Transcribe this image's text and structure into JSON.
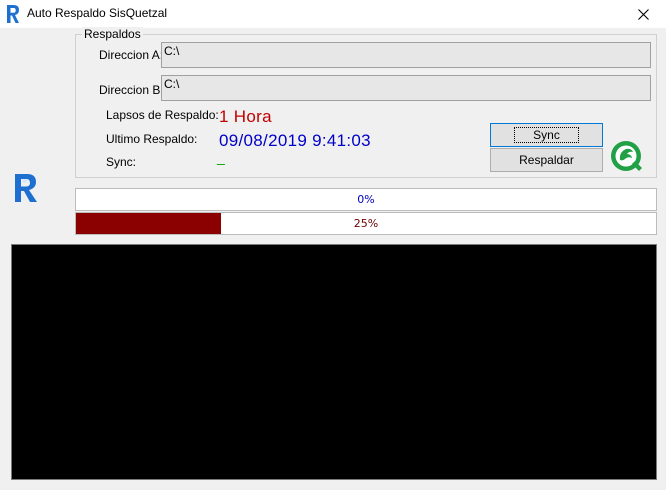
{
  "window": {
    "title": "Auto Respaldo SisQuetzal"
  },
  "group": {
    "legend": "Respaldos",
    "dir_a_label": "Direccion A:",
    "dir_a_value": "C:\\",
    "dir_b_label": "Direccion B:",
    "dir_b_value": "C:\\",
    "lapsos_label": "Lapsos de Respaldo:",
    "lapsos_value": "1 Hora",
    "ultimo_label": "Ultimo Respaldo:",
    "ultimo_value": "09/08/2019 9:41:03",
    "sync_label": "Sync:",
    "sync_value": "_"
  },
  "buttons": {
    "sync": "Sync",
    "respaldar": "Respaldar"
  },
  "progress": [
    {
      "text": "0%",
      "value": 0,
      "fill_color": "#8b0000",
      "text_color": "#0000c0"
    },
    {
      "text": "25%",
      "value": 25,
      "fill_color": "#8b0000",
      "text_color": "#6b0000"
    }
  ],
  "colors": {
    "lapsos": "#c00000",
    "ultimo": "#0000c8",
    "sync": "#00a000",
    "brand_blue": "#1e6fd0",
    "brand_green": "#22a046"
  },
  "icons": {
    "app": "r-logo-icon",
    "close": "close-icon",
    "brand": "sisquetzal-logo-icon"
  }
}
